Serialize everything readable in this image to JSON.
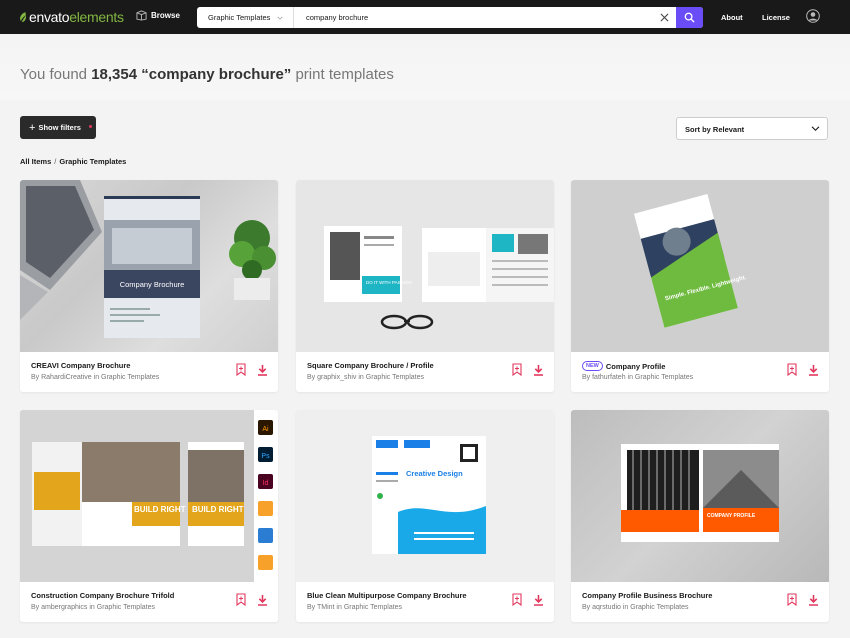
{
  "brand": {
    "logo_prefix": "envato",
    "logo_suffix": "elements"
  },
  "nav": {
    "browse": "Browse",
    "about": "About",
    "license": "License"
  },
  "search": {
    "category": "Graphic Templates",
    "query": "company brochure"
  },
  "results": {
    "prefix": "You found",
    "count": "18,354",
    "query": "“company brochure”",
    "suffix": "print templates"
  },
  "toolbar": {
    "show_filters": "Show filters",
    "sort": "Sort by Relevant"
  },
  "breadcrumb": {
    "root": "All Items",
    "sep": "/",
    "current": "Graphic Templates"
  },
  "cards": [
    {
      "title": "CREAVI Company Brochure",
      "byline": "By RahardiCreative in Graphic Templates",
      "is_new": false,
      "thumb_text": "Company Brochure"
    },
    {
      "title": "Square Company Brochure / Profile",
      "byline": "By graphix_shiv in Graphic Templates",
      "is_new": false,
      "thumb_text": "DO IT WITH PASSION"
    },
    {
      "title": "Company Profile",
      "byline": "By fathurfateh in Graphic Templates",
      "is_new": true,
      "badge": "NEW",
      "thumb_text": "Simple. Flexible. Lightweight."
    },
    {
      "title": "Construction Company Brochure Trifold",
      "byline": "By ambergraphics in Graphic Templates",
      "is_new": false,
      "thumb_text": "BUILD RIGHT"
    },
    {
      "title": "Blue Clean Multipurpose Company Brochure",
      "byline": "By TMint in Graphic Templates",
      "is_new": false,
      "thumb_text": "Creative Design"
    },
    {
      "title": "Company Profile Business Brochure",
      "byline": "By aqrstudio in Graphic Templates",
      "is_new": false,
      "thumb_text": "COMPANY PROFILE"
    }
  ],
  "app_icons": [
    "Ai",
    "Ps",
    "Id"
  ],
  "colors": {
    "accent": "#6b4df7",
    "brand_green": "#82b541",
    "icon_pink": "#e2385e",
    "topbar": "#191919"
  }
}
